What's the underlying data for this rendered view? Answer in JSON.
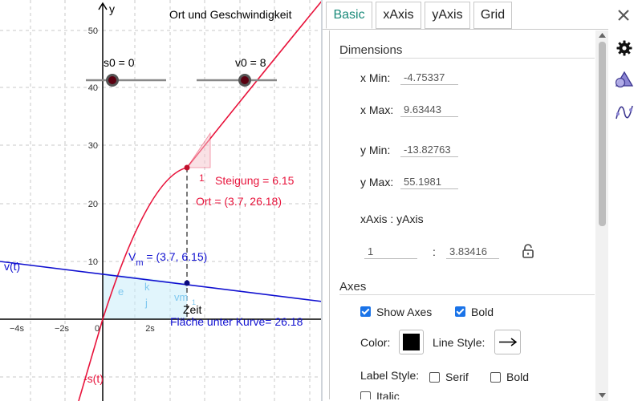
{
  "graph": {
    "title": "Ort und Geschwindigkeit",
    "y_axis_label": "y",
    "y_ticks": [
      "50",
      "40",
      "30",
      "20",
      "10"
    ],
    "x_ticks": [
      "−4s",
      "−2s",
      "0",
      "2s"
    ],
    "slider_s0": "s0 = 0",
    "slider_v0": "v0 = 8",
    "steigung": "Steigung = 6.15",
    "triangle_label": "1",
    "ort": "Ort = (3.7, 26.18)",
    "vm_prefix": "V",
    "vm_sub": "m",
    "vm_suffix": " = (3.7, 6.15)",
    "vt_label": "v(t)",
    "st_label": "-s(t)",
    "zeit": "Zeit",
    "flaeche": "Fläche unter Kurve= 26.18",
    "area_labels": [
      "e",
      "k",
      "j",
      "vm",
      "1"
    ],
    "colors": {
      "red": "#e8143c",
      "blue": "#1010d0",
      "black": "#000000"
    }
  },
  "tabs": [
    "Basic",
    "xAxis",
    "yAxis",
    "Grid"
  ],
  "dimensions": {
    "title": "Dimensions",
    "xmin_label": "x Min:",
    "xmin": "-4.75337",
    "xmax_label": "x Max:",
    "xmax": "9.63443",
    "ymin_label": "y Min:",
    "ymin": "-13.82763",
    "ymax_label": "y Max:",
    "ymax": "55.1981",
    "ratio_label": "xAxis : yAxis",
    "ratio_x": "1",
    "ratio_sep": ":",
    "ratio_y": "3.83416"
  },
  "axes": {
    "title": "Axes",
    "show_axes": "Show Axes",
    "bold": "Bold",
    "color_label": "Color:",
    "line_style_label": "Line Style:",
    "label_style": "Label Style:",
    "serif": "Serif",
    "bold2": "Bold",
    "italic": "Italic"
  },
  "icons": [
    "close-icon",
    "gear-icon",
    "shapes-icon",
    "graph-icon",
    "lock-icon"
  ]
}
